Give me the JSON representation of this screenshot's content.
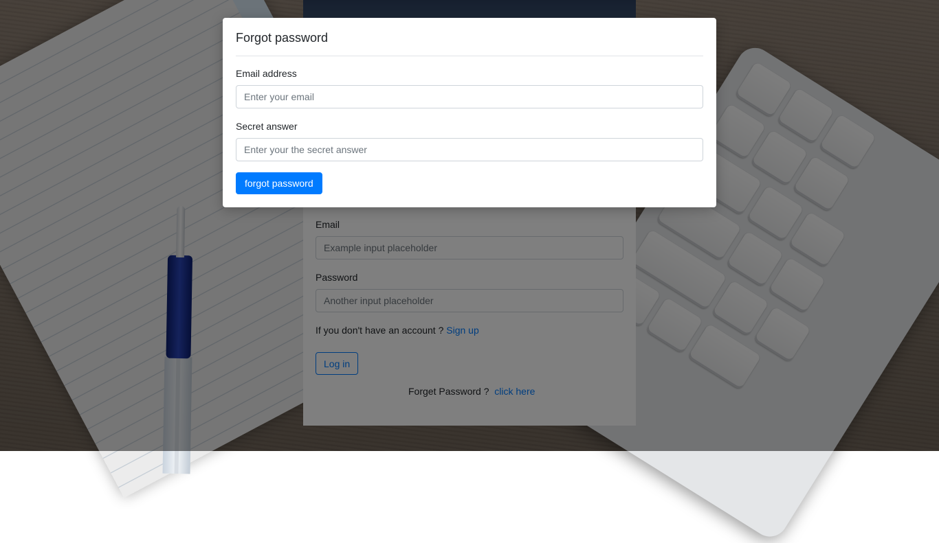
{
  "modal": {
    "title": "Forgot password",
    "email_label": "Email address",
    "email_placeholder": "Enter your email",
    "email_value": "",
    "secret_label": "Secret answer",
    "secret_placeholder": "Enter your the secret answer",
    "secret_value": "",
    "submit_label": "forgot password"
  },
  "login": {
    "email_label": "Email",
    "email_placeholder": "Example input placeholder",
    "password_label": "Password",
    "password_placeholder": "Another input placeholder",
    "signup_prompt": "If you don't have an account ?",
    "signup_link": "Sign up",
    "login_button": "Log in",
    "forget_prompt": "Forget Password ?",
    "forget_link": "click here"
  },
  "colors": {
    "primary": "#007bff",
    "backdrop": "rgba(0,0,0,0.5)"
  }
}
